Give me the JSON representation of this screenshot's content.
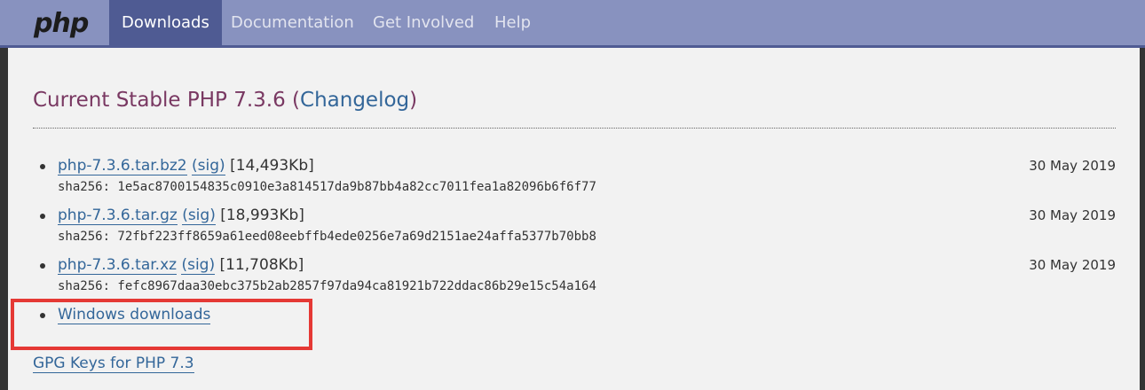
{
  "nav": {
    "logo": "php",
    "items": [
      {
        "label": "Downloads",
        "active": true
      },
      {
        "label": "Documentation",
        "active": false
      },
      {
        "label": "Get Involved",
        "active": false
      },
      {
        "label": "Help",
        "active": false
      }
    ]
  },
  "main": {
    "heading_prefix": "Current Stable PHP 7.3.6 (",
    "heading_link": "Changelog",
    "heading_suffix": ")",
    "downloads": [
      {
        "file": "php-7.3.6.tar.bz2",
        "sig": "(sig)",
        "size": "[14,493Kb]",
        "date": "30 May 2019",
        "sha": "sha256: 1e5ac8700154835c0910e3a814517da9b87bb4a82cc7011fea1a82096b6f6f77"
      },
      {
        "file": "php-7.3.6.tar.gz",
        "sig": "(sig)",
        "size": "[18,993Kb]",
        "date": "30 May 2019",
        "sha": "sha256: 72fbf223ff8659a61eed08eebffb4ede0256e7a69d2151ae24affa5377b70bb8"
      },
      {
        "file": "php-7.3.6.tar.xz",
        "sig": "(sig)",
        "size": "[11,708Kb]",
        "date": "30 May 2019",
        "sha": "sha256: fefc8967daa30ebc375b2ab2857f97da94ca81921b722ddac86b29e15c54a164"
      }
    ],
    "windows_link": "Windows downloads",
    "gpg_link": "GPG Keys for PHP 7.3"
  },
  "colors": {
    "navbar": "#8892bf",
    "nav_active": "#4f5b93",
    "heading": "#793862",
    "link": "#336699",
    "highlight": "#e53935"
  }
}
